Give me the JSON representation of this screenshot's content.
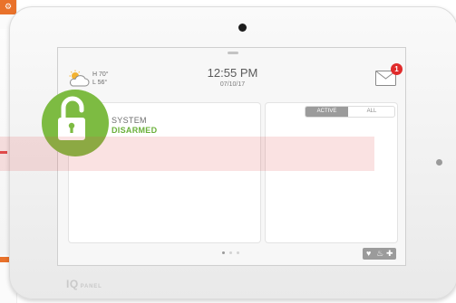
{
  "weather": {
    "high": "H 70°",
    "low": "L 56°",
    "icon": "partly-cloudy-icon"
  },
  "clock": {
    "time": "12:55 PM",
    "date": "07/10/17"
  },
  "messages": {
    "icon": "envelope-icon",
    "unread_count": "1"
  },
  "sensor_filter": {
    "active_label": "ACTIVE",
    "all_label": "ALL",
    "selected": "ACTIVE"
  },
  "system_status": {
    "line1": "SYSTEM",
    "line2": "DISARMED",
    "icon": "open-padlock-icon"
  },
  "pager": {
    "pages": 3,
    "current": 1
  },
  "quick_actions": {
    "icons": [
      "shield-icon",
      "fire-icon",
      "medical-cross-icon"
    ],
    "glyphs": [
      "♥",
      "♨",
      "✚"
    ]
  },
  "brand": {
    "logo": "IQ",
    "sub": "PANEL"
  },
  "colors": {
    "accent_green": "#7dbb42",
    "disarmed_text": "#6ab03a",
    "badge_red": "#e02b2b",
    "sidebar_orange": "#e9722b",
    "highlight_band": "#e24848"
  }
}
